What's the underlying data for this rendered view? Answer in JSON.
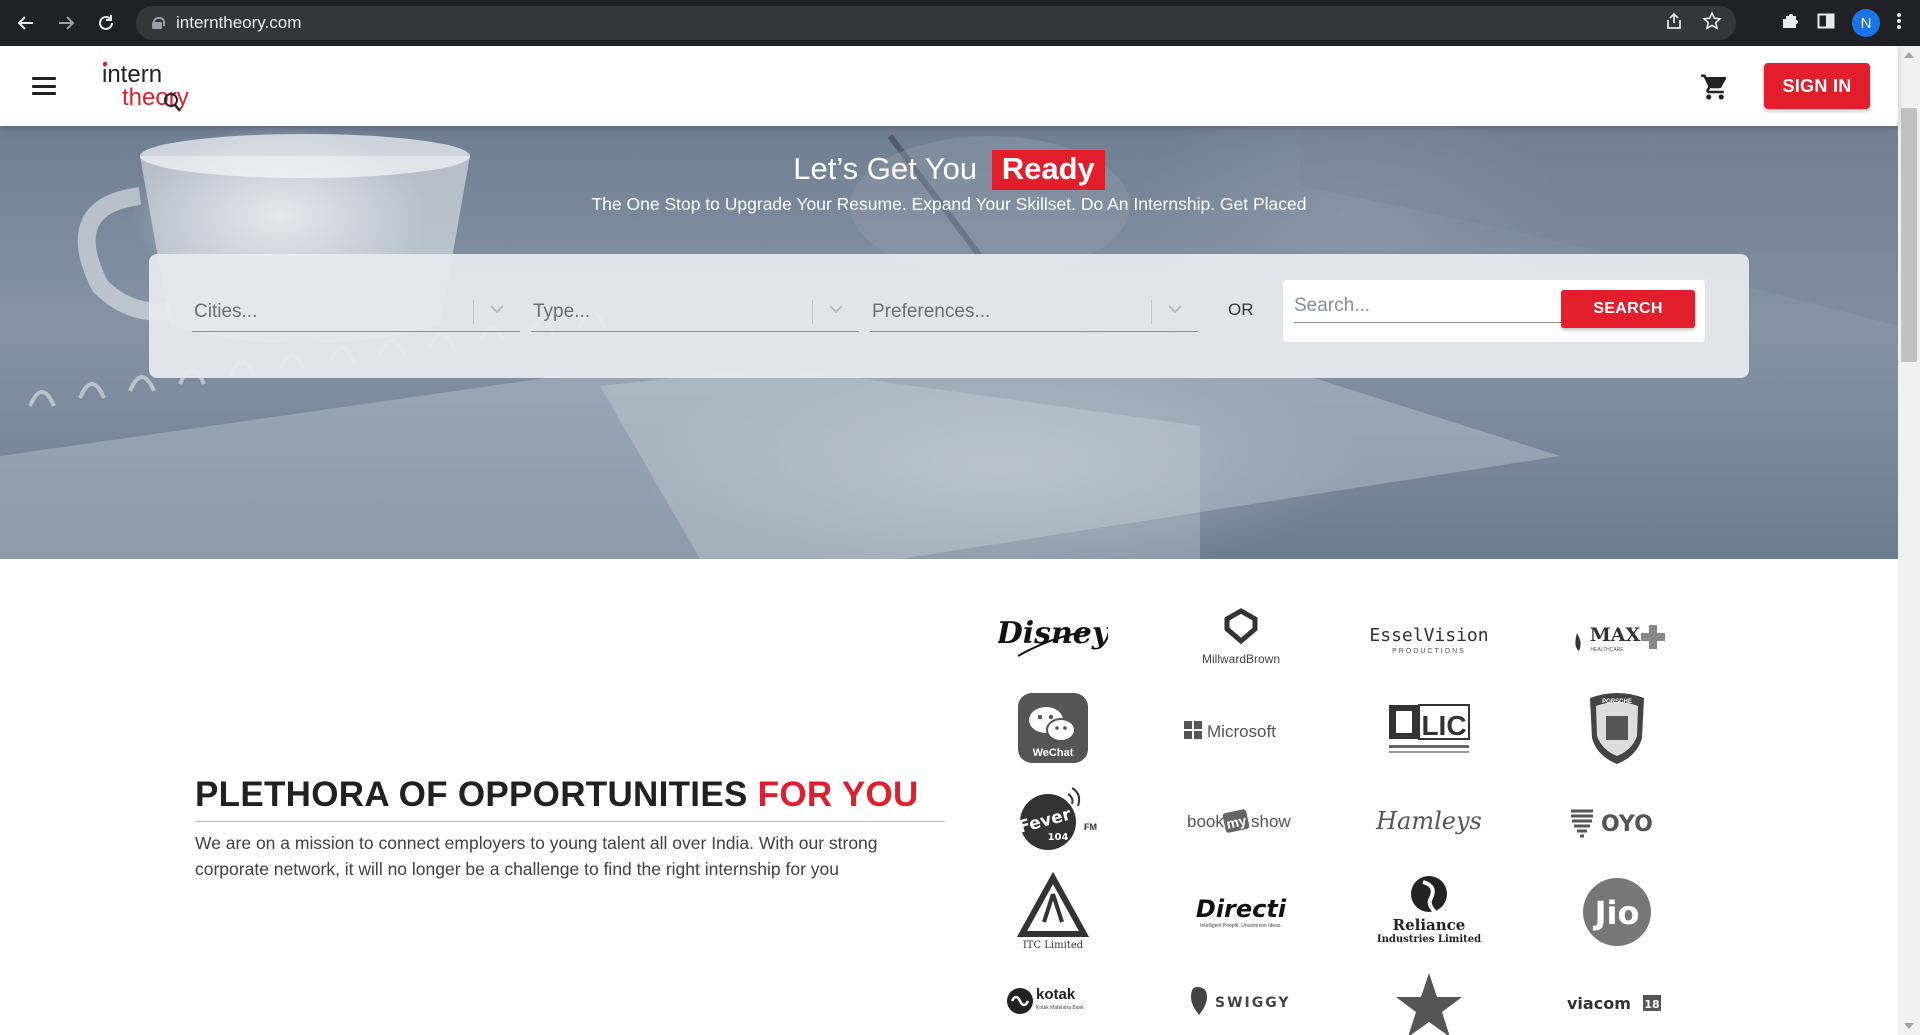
{
  "browser": {
    "url": "interntheory.com",
    "profile_initial": "N",
    "icons": [
      "back-icon",
      "forward-icon",
      "reload-icon",
      "lock-icon",
      "share-icon",
      "star-icon",
      "extensions-icon",
      "side-panel-icon",
      "menu-icon"
    ]
  },
  "header": {
    "logo_top": "intern",
    "logo_bottom": "theory",
    "signin_label": "SIGN IN",
    "brand_color": "#e31e2c"
  },
  "hero": {
    "title_prefix": "Let’s Get You",
    "title_highlight": "Ready",
    "subtitle": "The One Stop to Upgrade Your Resume. Expand Your Skillset. Do An Internship. Get Placed",
    "cities_placeholder": "Cities...",
    "type_placeholder": "Type...",
    "preferences_placeholder": "Preferences...",
    "or_label": "OR",
    "search_placeholder": "Search...",
    "search_button": "SEARCH"
  },
  "opportunities": {
    "title_main": "PLETHORA OF OPPORTUNITIES",
    "title_highlight": "FOR YOU",
    "description": "We are on a mission to connect employers to young talent all over India. With our strong corporate network, it will no longer be a challenge to find the right internship for you"
  },
  "partners": {
    "disney": "Disney",
    "millward": "MillwardBrown",
    "essel": "EsselVision",
    "essel_sub": "PRODUCTIONS",
    "max": "MAX",
    "max_sub": "HEALTHCARE",
    "wechat": "WeChat",
    "microsoft": "Microsoft",
    "lic": "LIC",
    "porsche": "PORSCHE",
    "fever": "Fever",
    "fever_num": "104",
    "fever_fm": "FM",
    "bookmyshow_a": "book",
    "bookmyshow_b": "my",
    "bookmyshow_c": "show",
    "hamleys": "Hamleys",
    "oyo": "OYO",
    "itc": "ITC Limited",
    "directi": "Directi",
    "directi_sub": "Intelligent People. Uncommon Ideas.",
    "reliance": "Reliance",
    "reliance_sub": "Industries Limited",
    "jio": "Jio",
    "kotak": "kotak",
    "kotak_sub": "Kotak Mahindra Bank",
    "swiggy": "SWIGGY",
    "viacom": "viacom",
    "viacom_num": "18"
  }
}
